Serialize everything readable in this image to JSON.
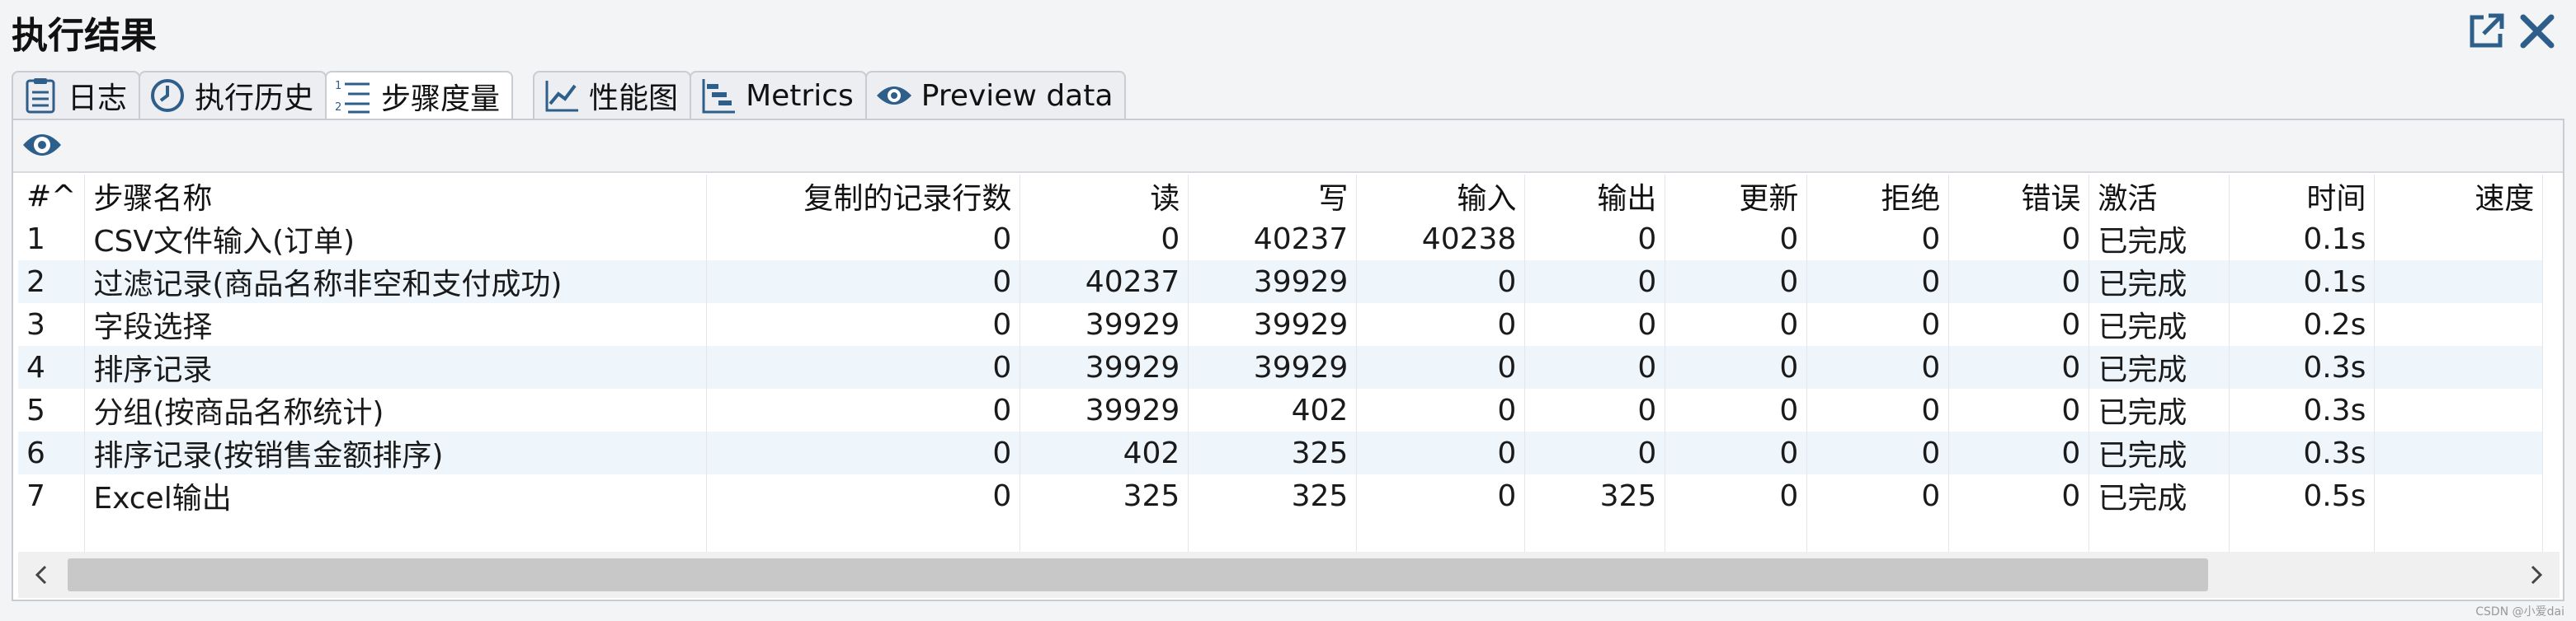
{
  "window": {
    "title": "执行结果",
    "watermark": "CSDN @小爱dai"
  },
  "tabs": [
    {
      "label": "日志",
      "icon": "log-icon"
    },
    {
      "label": "执行历史",
      "icon": "clock-icon"
    },
    {
      "label": "步骤度量",
      "icon": "numbered-list-icon",
      "active": true
    },
    {
      "label": "性能图",
      "icon": "line-chart-icon"
    },
    {
      "label": "Metrics",
      "icon": "gantt-icon"
    },
    {
      "label": "Preview data",
      "icon": "eye-icon"
    }
  ],
  "table": {
    "columns": [
      "#^",
      "步骤名称",
      "复制的记录行数",
      "读",
      "写",
      "输入",
      "输出",
      "更新",
      "拒绝",
      "错误",
      "激活",
      "时间",
      "速度"
    ],
    "rows": [
      [
        "1",
        "CSV文件输入(订单)",
        "0",
        "0",
        "40237",
        "40238",
        "0",
        "0",
        "0",
        "0",
        "已完成",
        "0.1s",
        ""
      ],
      [
        "2",
        "过滤记录(商品名称非空和支付成功)",
        "0",
        "40237",
        "39929",
        "0",
        "0",
        "0",
        "0",
        "0",
        "已完成",
        "0.1s",
        ""
      ],
      [
        "3",
        "字段选择",
        "0",
        "39929",
        "39929",
        "0",
        "0",
        "0",
        "0",
        "0",
        "已完成",
        "0.2s",
        ""
      ],
      [
        "4",
        "排序记录",
        "0",
        "39929",
        "39929",
        "0",
        "0",
        "0",
        "0",
        "0",
        "已完成",
        "0.3s",
        ""
      ],
      [
        "5",
        "分组(按商品名称统计)",
        "0",
        "39929",
        "402",
        "0",
        "0",
        "0",
        "0",
        "0",
        "已完成",
        "0.3s",
        ""
      ],
      [
        "6",
        "排序记录(按销售金额排序)",
        "0",
        "402",
        "325",
        "0",
        "0",
        "0",
        "0",
        "0",
        "已完成",
        "0.3s",
        ""
      ],
      [
        "7",
        "Excel输出",
        "0",
        "325",
        "325",
        "0",
        "325",
        "0",
        "0",
        "0",
        "已完成",
        "0.5s",
        ""
      ]
    ]
  },
  "colors": {
    "accent": "#2e5f8a",
    "row_alt": "#eef5fb",
    "border": "#c9cdd3"
  }
}
